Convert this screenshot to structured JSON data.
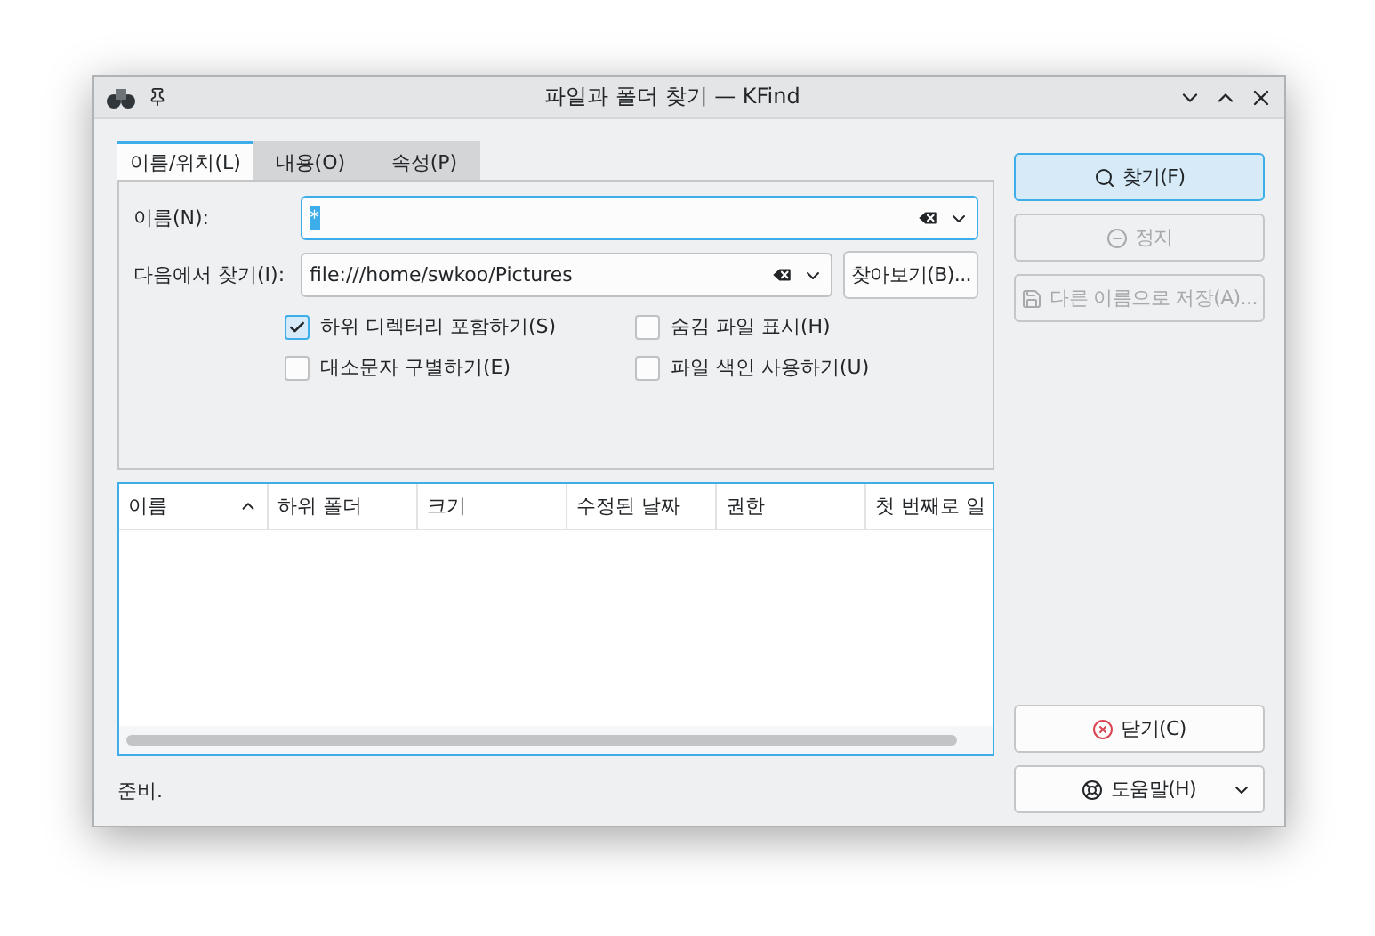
{
  "window": {
    "title": "파일과 폴더 찾기 — KFind"
  },
  "tabs": [
    {
      "label": "이름/위치(L)",
      "selected": true
    },
    {
      "label": "내용(O)",
      "selected": false
    },
    {
      "label": "속성(P)",
      "selected": false
    }
  ],
  "name_field": {
    "label": "이름(N):",
    "value": "*",
    "value_selected": true
  },
  "location_field": {
    "label": "다음에서 찾기(I):",
    "value": "file:///home/swkoo/Pictures",
    "browse_button": "찾아보기(B)..."
  },
  "options": [
    {
      "label": "하위 디렉터리 포함하기(S)",
      "checked": true
    },
    {
      "label": "숨김 파일 표시(H)",
      "checked": false
    },
    {
      "label": "대소문자 구별하기(E)",
      "checked": false
    },
    {
      "label": "파일 색인 사용하기(U)",
      "checked": false
    }
  ],
  "table": {
    "columns": [
      {
        "label": "이름",
        "sorted": true
      },
      {
        "label": "하위 폴더",
        "sorted": false
      },
      {
        "label": "크기",
        "sorted": false
      },
      {
        "label": "수정된 날짜",
        "sorted": false
      },
      {
        "label": "권한",
        "sorted": false
      },
      {
        "label": "첫 번째로 일",
        "sorted": false
      }
    ]
  },
  "actions": [
    {
      "kind": "find",
      "label": "찾기(F)",
      "disabled": false,
      "default": true
    },
    {
      "kind": "stop",
      "label": "정지",
      "disabled": true,
      "default": false
    },
    {
      "kind": "save",
      "label": "다른 이름으로 저장(A)...",
      "disabled": true,
      "default": false
    }
  ],
  "bottom_actions": [
    {
      "kind": "close",
      "label": "닫기(C)",
      "disabled": false,
      "default": false
    },
    {
      "kind": "help",
      "label": "도움말(H)",
      "disabled": false,
      "default": false
    }
  ],
  "status_bar": "준비."
}
